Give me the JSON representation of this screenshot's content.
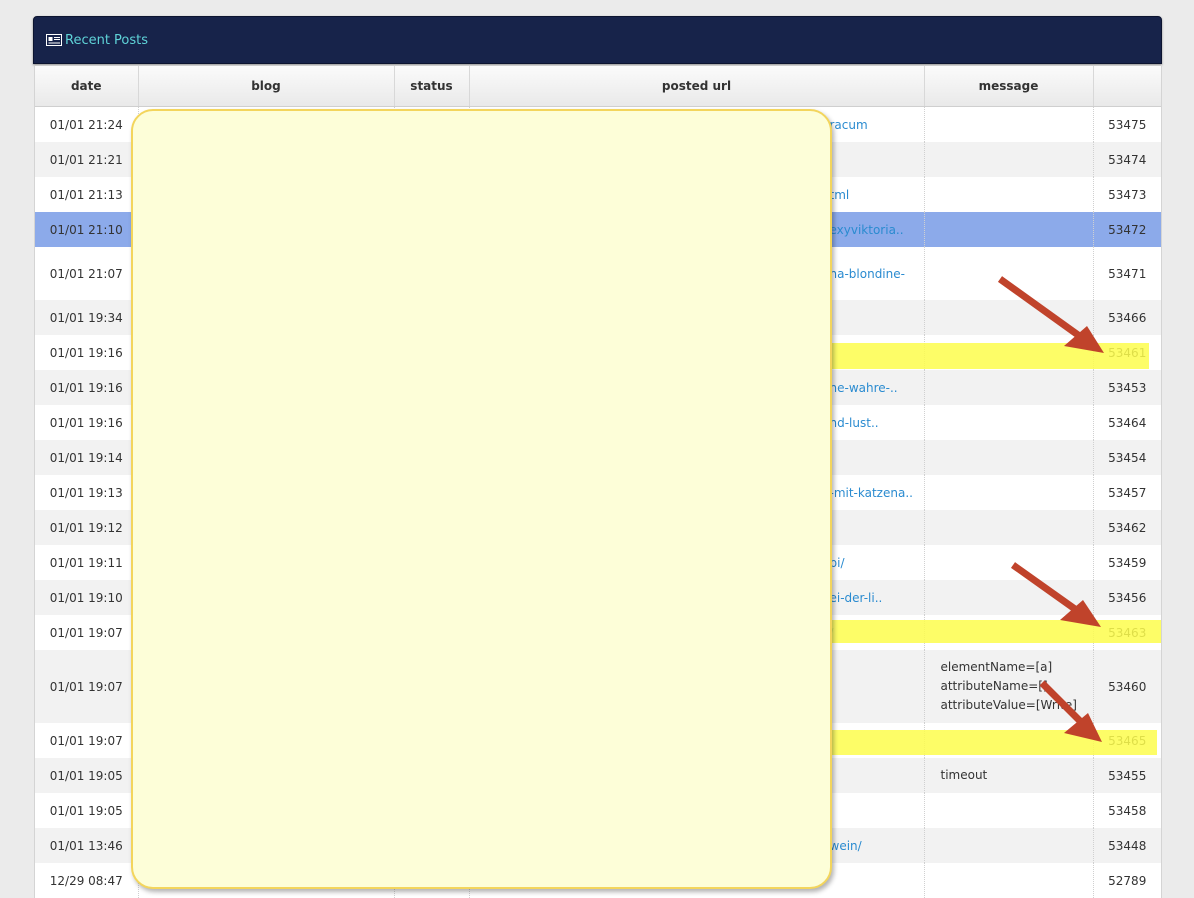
{
  "panel": {
    "title": "Recent Posts",
    "icon": "news-icon",
    "header_color": "#17234a",
    "title_color": "#5fd3d8"
  },
  "columns": [
    "date",
    "blog",
    "status",
    "posted url",
    "message",
    ""
  ],
  "rows": [
    {
      "date": "01/01 21:24",
      "url": "racum",
      "message": "",
      "id": "53475",
      "style": "odd"
    },
    {
      "date": "01/01 21:21",
      "url": "",
      "message": "",
      "id": "53474",
      "style": "even"
    },
    {
      "date": "01/01 21:13",
      "url": "tml",
      "message": "",
      "id": "53473",
      "style": "odd"
    },
    {
      "date": "01/01 21:10",
      "url": "exyviktoria..",
      "message": "",
      "id": "53472",
      "style": "selected"
    },
    {
      "date": "01/01 21:07",
      "url": "na-blondine-",
      "message": "",
      "id": "53471",
      "style": "odd tall"
    },
    {
      "date": "01/01 19:34",
      "url": "",
      "message": "",
      "id": "53466",
      "style": "even"
    },
    {
      "date": "01/01 19:16",
      "url": "",
      "message": "",
      "id": "53461",
      "style": "odd"
    },
    {
      "date": "01/01 19:16",
      "url": "ne-wahre-..",
      "message": "",
      "id": "53453",
      "style": "even"
    },
    {
      "date": "01/01 19:16",
      "url": "nd-lust..",
      "message": "",
      "id": "53464",
      "style": "odd"
    },
    {
      "date": "01/01 19:14",
      "url": "",
      "message": "",
      "id": "53454",
      "style": "even"
    },
    {
      "date": "01/01 19:13",
      "url": "-mit-katzena..",
      "message": "",
      "id": "53457",
      "style": "odd"
    },
    {
      "date": "01/01 19:12",
      "url": "",
      "message": "",
      "id": "53462",
      "style": "even"
    },
    {
      "date": "01/01 19:11",
      "url": "bi/",
      "message": "",
      "id": "53459",
      "style": "odd"
    },
    {
      "date": "01/01 19:10",
      "url": "ei-der-li..",
      "message": "",
      "id": "53456",
      "style": "even"
    },
    {
      "date": "01/01 19:07",
      "url": "/",
      "message": "",
      "id": "53463",
      "style": "odd"
    },
    {
      "date": "01/01 19:07",
      "url": "",
      "message_lines": [
        "elementName=[a]",
        "attributeName=[]",
        "attributeValue=[Write]"
      ],
      "id": "53460",
      "style": "even xtall"
    },
    {
      "date": "01/01 19:07",
      "url": "",
      "message": "",
      "id": "53465",
      "style": "odd"
    },
    {
      "date": "01/01 19:05",
      "url": "",
      "message": "timeout",
      "id": "53455",
      "style": "even"
    },
    {
      "date": "01/01 19:05",
      "url": "",
      "message": "",
      "id": "53458",
      "style": "odd"
    },
    {
      "date": "01/01 13:46",
      "url": "wein/",
      "message": "",
      "id": "53448",
      "style": "even"
    },
    {
      "date": "12/29 08:47",
      "url": "",
      "message": "",
      "id": "52789",
      "style": "odd"
    }
  ],
  "highlight_color": "#fdfd4c",
  "arrow_color": "#c0432b",
  "overlay_color": "#fdfed8"
}
